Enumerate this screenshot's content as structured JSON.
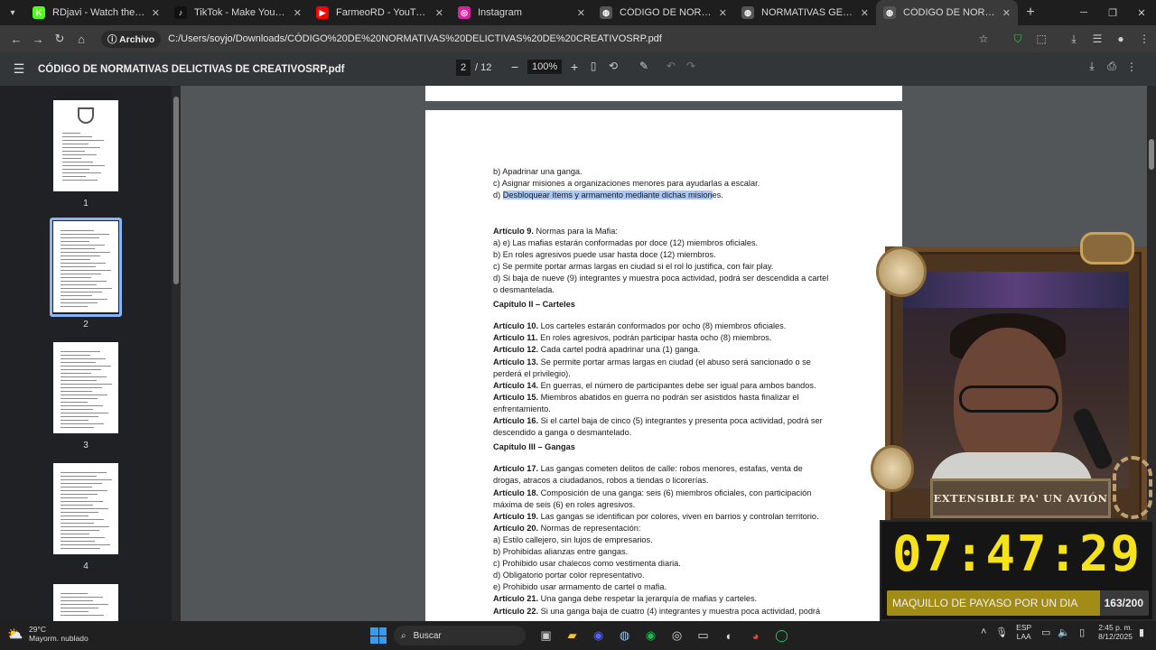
{
  "browser": {
    "tabs": [
      {
        "label": "RDjavi - Watch the VOD on Kick",
        "icon": "kick-icon",
        "color": "#53fc18",
        "glyph": "K"
      },
      {
        "label": "TikTok - Make Your Day",
        "icon": "tiktok-icon",
        "color": "#111111",
        "glyph": "♪"
      },
      {
        "label": "FarmeoRD - YouTube",
        "icon": "youtube-icon",
        "color": "#ff0000",
        "glyph": "▶"
      },
      {
        "label": "Instagram",
        "icon": "instagram-icon",
        "color": "#d6249f",
        "glyph": "◎"
      },
      {
        "label": "CÓDIGO DE NORMATIVAS GENERALES",
        "icon": "globe-icon",
        "color": "#555555",
        "glyph": "◍"
      },
      {
        "label": "NORMATIVAS GENERALES POLICIALES",
        "icon": "globe-icon",
        "color": "#555555",
        "glyph": "◍"
      },
      {
        "label": "CÓDIGO DE NORMATIVAS DELICTIVAS",
        "icon": "globe-icon",
        "color": "#555555",
        "glyph": "◍"
      }
    ],
    "site_chip": "Archivo",
    "url": "C:/Users/soyjo/Downloads/CÓDIGO%20DE%20NORMATIVAS%20DELICTIVAS%20DE%20CREATIVOSRP.pdf"
  },
  "pdf": {
    "title": "CÓDIGO DE NORMATIVAS DELICTIVAS DE CREATIVOSRP.pdf",
    "current_page": "2",
    "total_pages": "/ 12",
    "zoom": "100%",
    "thumbnails": [
      "1",
      "2",
      "3",
      "4"
    ]
  },
  "document": {
    "lines": [
      {
        "t": "b) Apadrinar una ganga."
      },
      {
        "t": "c) Asignar misiones a organizaciones menores para ayudarlas a escalar."
      },
      {
        "pre": "d) ",
        "hl": "Desbloquear ítems y armamento mediante dichas mision",
        "t": "es."
      },
      {
        "t": ""
      },
      {
        "t": ""
      },
      {
        "b": "Artículo 9.",
        "t": " Normas para la Mafia:"
      },
      {
        "t": "a) e) Las mafias estarán conformadas por doce (12) miembros oficiales."
      },
      {
        "t": "b) En roles agresivos puede usar hasta doce (12) miembros."
      },
      {
        "t": "c) Se permite portar armas largas en ciudad si el rol lo justifica, con fair play."
      },
      {
        "t": "d) Si baja de nueve (9) integrantes y muestra poca actividad, podrá ser descendida a cartel"
      },
      {
        "t": "o desmantelada."
      },
      {
        "chap": "Capítulo II – Carteles"
      },
      {
        "b": "Artículo 10.",
        "t": " Los carteles estarán conformados por ocho (8) miembros oficiales."
      },
      {
        "b": "Artículo 11.",
        "t": " En roles agresivos, podrán participar hasta ocho (8) miembros."
      },
      {
        "b": "Artículo 12.",
        "t": " Cada cartel podrá apadrinar una (1) ganga."
      },
      {
        "b": "Artículo 13.",
        "t": " Se permite portar armas largas en ciudad (el abuso será sancionado o se"
      },
      {
        "t": "perderá el privilegio)."
      },
      {
        "b": "Artículo 14.",
        "t": " En guerras, el número de participantes debe ser igual para ambos bandos."
      },
      {
        "b": "Artículo 15.",
        "t": " Miembros abatidos en guerra no podrán ser asistidos hasta finalizar el"
      },
      {
        "t": "enfrentamiento."
      },
      {
        "b": "Artículo 16.",
        "t": " Si el cartel baja de cinco (5) integrantes y presenta poca actividad, podrá ser"
      },
      {
        "t": "descendido a ganga o desmantelado."
      },
      {
        "chap": "Capítulo III – Gangas"
      },
      {
        "b": "Artículo 17.",
        "t": " Las gangas cometen delitos de calle: robos menores, estafas, venta de"
      },
      {
        "t": "drogas, atracos a ciudadanos, robos a tiendas o licorerías."
      },
      {
        "b": "Artículo 18.",
        "t": " Composición de una ganga: seis (6) miembros oficiales, con participación"
      },
      {
        "t": "máxima de seis (6) en roles agresivos."
      },
      {
        "b": "Artículo 19.",
        "t": " Las gangas se identifican por colores, viven en barrios y controlan territorio."
      },
      {
        "b": "Artículo 20.",
        "t": " Normas de representación:"
      },
      {
        "t": "a) Estilo callejero, sin lujos de empresarios."
      },
      {
        "t": "b) Prohibidas alianzas entre gangas."
      },
      {
        "t": "c) Prohibido usar chalecos como vestimenta diaria."
      },
      {
        "t": "d) Obligatorio portar color representativo."
      },
      {
        "t": "e) Prohibido usar armamento de cartel o mafia."
      },
      {
        "b": "Artículo 21.",
        "t": " Una ganga debe respetar la jerarquía de mafias y carteles."
      },
      {
        "b": "Artículo 22.",
        "t": " Si una ganga baja de cuatro (4) integrantes y muestra poca actividad, podrá"
      }
    ]
  },
  "stream_overlay": {
    "banner": "EXTENSIBLE PA' UN AVIÓN",
    "timer": "07:47:29",
    "goal_label": "MAQUILLO DE PAYASO POR UN DIA",
    "goal_count": "163/200",
    "goal_progress": 0.815,
    "timer_color": "#f5e21a"
  },
  "taskbar": {
    "temperature": "29°C",
    "weather": "Mayorm. nublado",
    "search_placeholder": "Buscar",
    "lang_top": "ESP",
    "lang_bottom": "LAA",
    "time": "2:45 p. m.",
    "date": "8/12/2025"
  }
}
